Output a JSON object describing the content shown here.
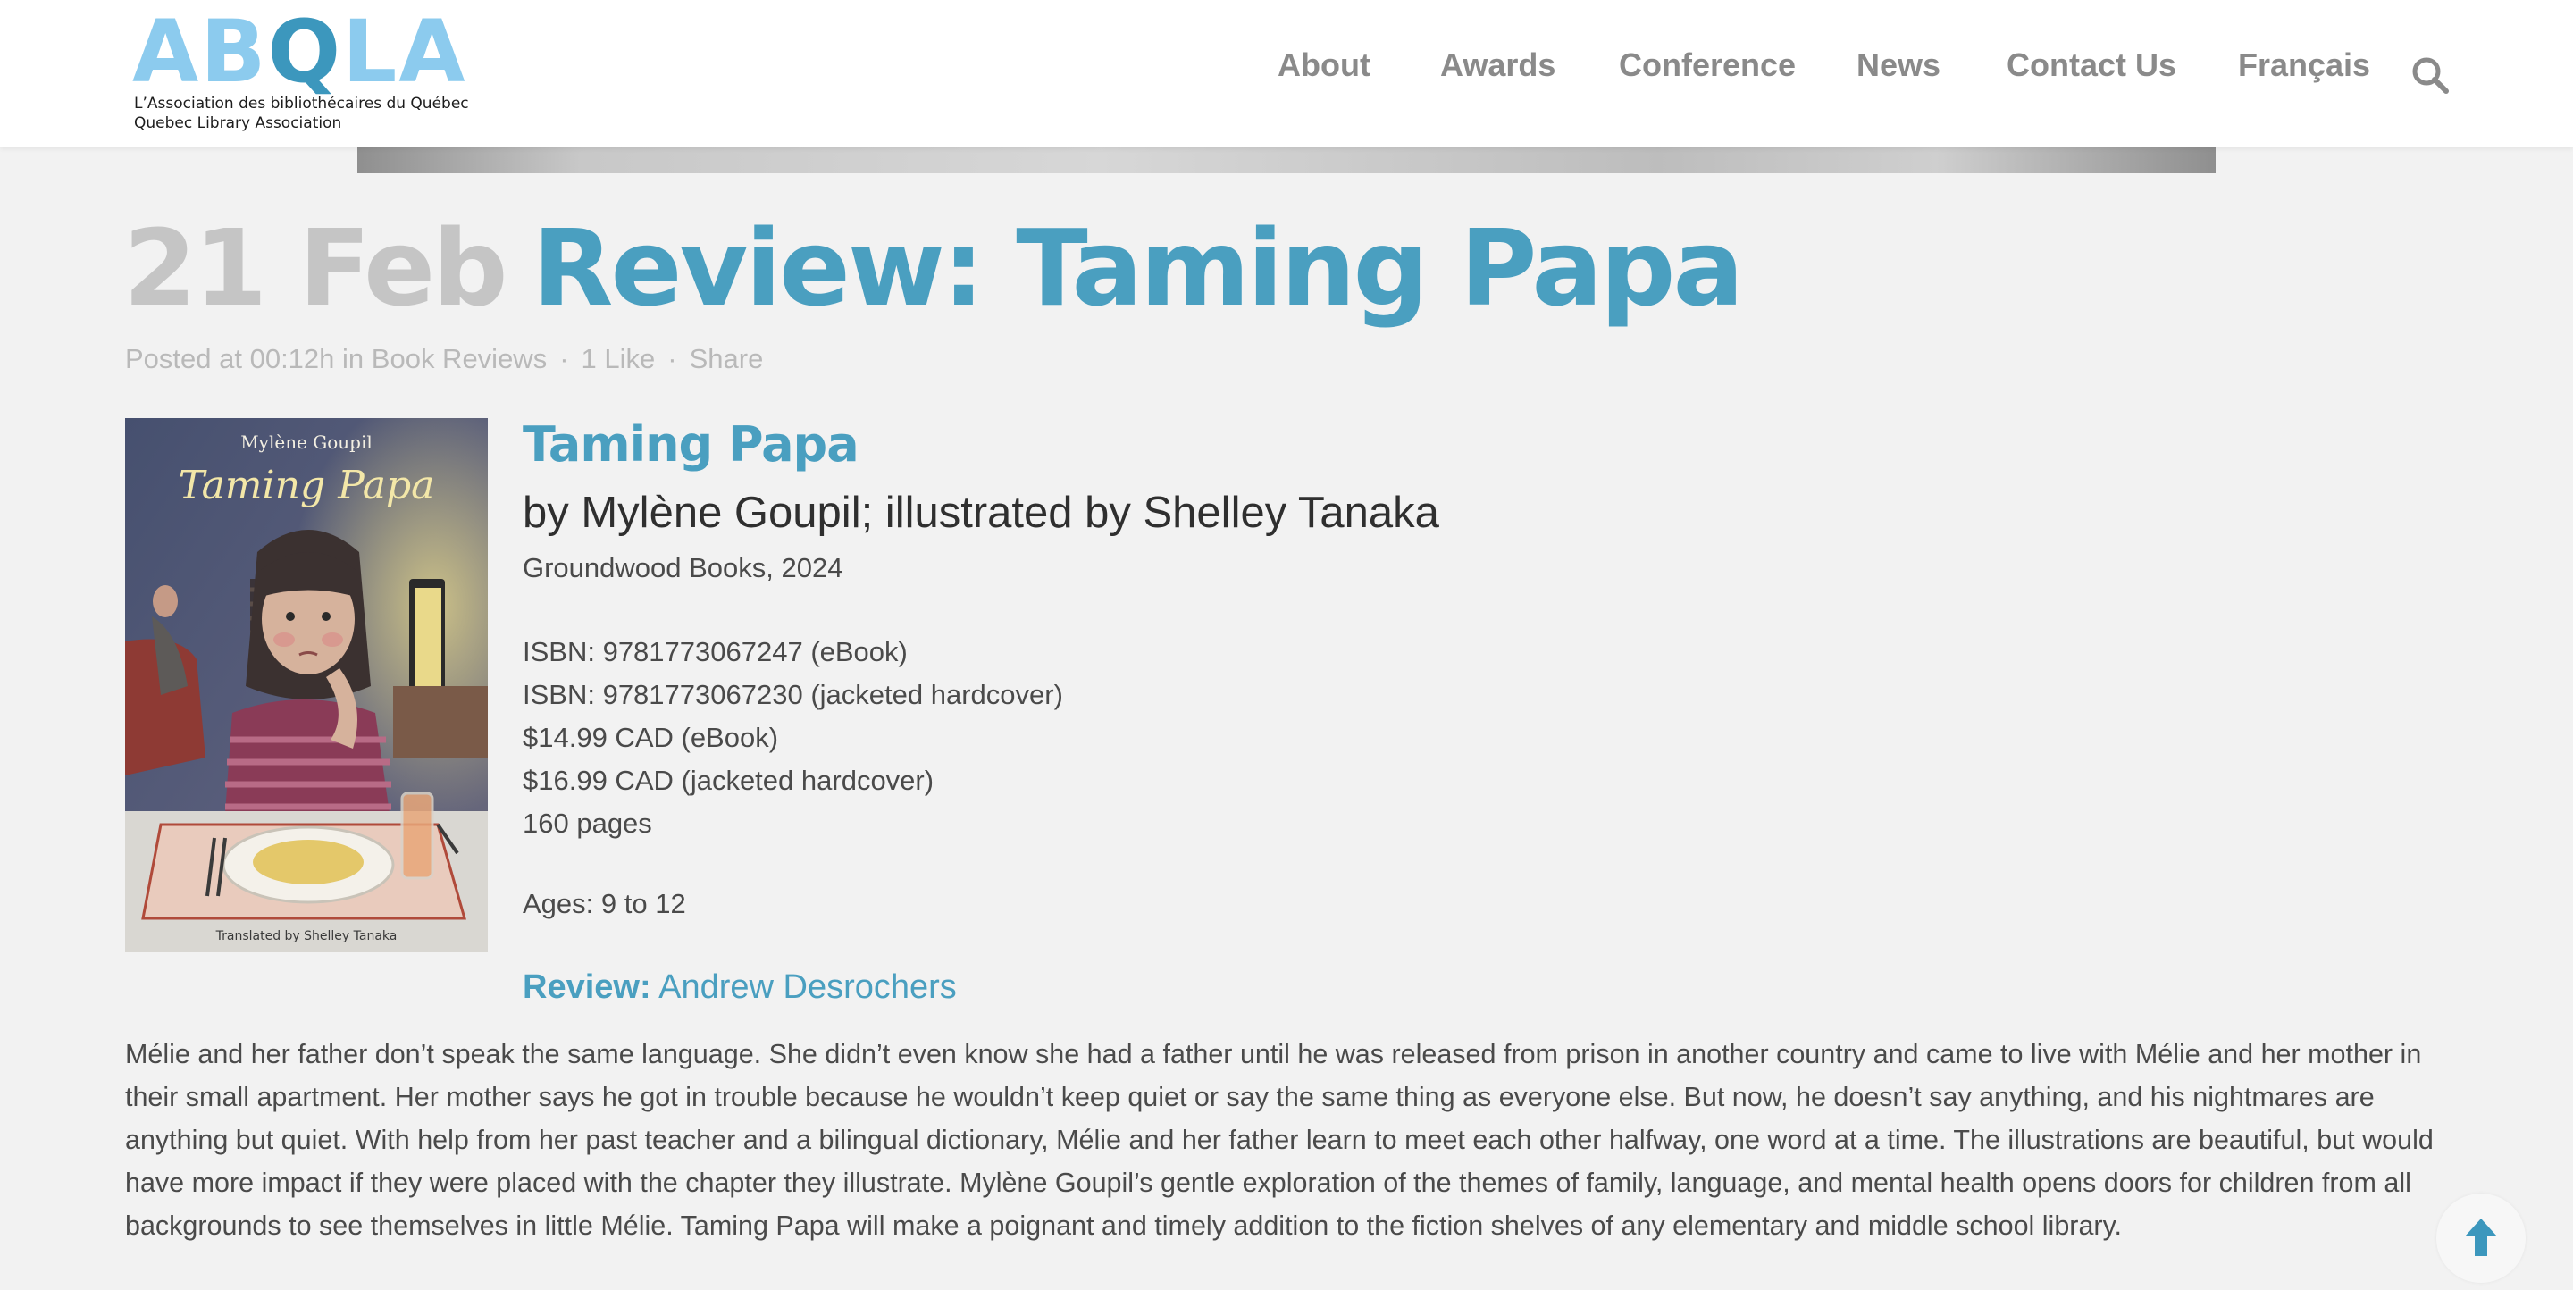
{
  "site": {
    "logo_text": "ABQLA",
    "logo_line1": "L’Association des bibliothécaires du Québec",
    "logo_line2": "Quebec Library Association"
  },
  "nav": {
    "items": [
      "About",
      "Awards",
      "Conference",
      "News",
      "Contact Us",
      "Français"
    ],
    "search_icon": "search-icon"
  },
  "post": {
    "date": "21 Feb",
    "title": "Review: Taming Papa",
    "meta": {
      "posted_prefix": "Posted at 00:12h in",
      "category": "Book Reviews",
      "likes": "1 Like",
      "share": "Share"
    }
  },
  "book": {
    "cover": {
      "author": "Mylène Goupil",
      "title": "Taming Papa",
      "translator": "Translated by Shelley Tanaka"
    },
    "title": "Taming Papa",
    "byline": "by Mylène Goupil; illustrated by Shelley Tanaka",
    "publisher": "Groundwood Books, 2024",
    "details": [
      "ISBN: 9781773067247 (eBook)",
      "ISBN: 9781773067230 (jacketed hardcover)",
      "$14.99 CAD (eBook)",
      "$16.99 CAD (jacketed hardcover)",
      "160 pages"
    ],
    "ages": "Ages: 9 to 12"
  },
  "review": {
    "label": "Review:",
    "author": "Andrew Desrochers",
    "body": "Mélie and her father don’t speak the same language. She didn’t even know she had a father until he was released from prison in another country and came to live with Mélie and her mother in their small apartment. Her mother says he got in trouble because he wouldn’t keep quiet or say the same thing as everyone else. But now, he doesn’t say anything, and his nightmares are anything but quiet. With help from her past teacher and a bilingual dictionary, Mélie and her father learn to meet each other halfway, one word at a time. The illustrations are beautiful, but would have more impact if they were placed with the chapter they illustrate. Mylène Goupil’s gentle exploration of the themes of family, language, and mental health opens doors for children from all backgrounds to see themselves in little Mélie. Taming Papa will make a poignant and timely addition to the fiction shelves of any elementary and middle school library."
  },
  "colors": {
    "accent": "#4a9fc0",
    "logo_light": "#8ccbee",
    "date_gray": "#c5c5c5",
    "nav_gray": "#8a8a8a",
    "background": "#f2f2f2"
  },
  "back_to_top_icon": "arrow-up-icon"
}
